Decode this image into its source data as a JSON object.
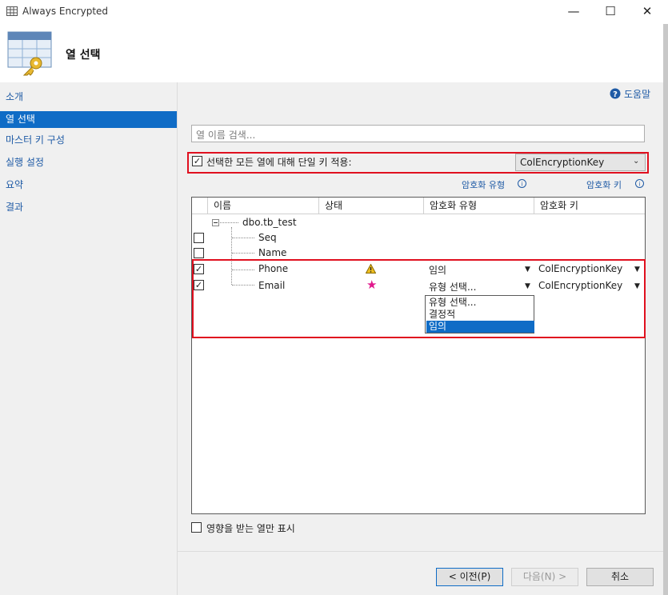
{
  "window": {
    "title": "Always Encrypted",
    "minimize_glyph": "—",
    "maximize_glyph": "☐",
    "close_glyph": "✕"
  },
  "header": {
    "title": "열 선택",
    "icon": "table-key-icon"
  },
  "sidebar": {
    "items": [
      {
        "label": "소개",
        "active": false
      },
      {
        "label": "열 선택",
        "active": true
      },
      {
        "label": "마스터 키 구성",
        "active": false
      },
      {
        "label": "실행 설정",
        "active": false
      },
      {
        "label": "요약",
        "active": false
      },
      {
        "label": "결과",
        "active": false
      }
    ]
  },
  "help": {
    "label": "도움말",
    "icon": "help-icon"
  },
  "search": {
    "placeholder": "열 이름 검색..."
  },
  "single_key": {
    "checked": true,
    "label": "선택한 모든 열에 대해 단일 키 적용:",
    "selected_key": "ColEncryptionKey"
  },
  "links": {
    "encryption_type": "암호화 유형",
    "encryption_key": "암호화 키"
  },
  "grid": {
    "columns": [
      "이름",
      "상태",
      "암호화 유형",
      "암호화 키"
    ],
    "table_node": "dbo.tb_test",
    "rows": [
      {
        "name": "Seq",
        "checked": false,
        "status": "",
        "enc_type": "",
        "enc_key": ""
      },
      {
        "name": "Name",
        "checked": false,
        "status": "",
        "enc_type": "",
        "enc_key": ""
      },
      {
        "name": "Phone",
        "checked": true,
        "status": "warning",
        "enc_type": "임의",
        "enc_key": "ColEncryptionKey"
      },
      {
        "name": "Email",
        "checked": true,
        "status": "new",
        "enc_type": "유형 선택...",
        "enc_key": "ColEncryptionKey"
      }
    ],
    "status_colors": {
      "warning": "#f0c020",
      "new": "#e0188c"
    }
  },
  "type_dropdown": {
    "options": [
      "유형 선택...",
      "결정적",
      "임의"
    ],
    "selected": "임의"
  },
  "affected_only": {
    "checked": false,
    "label": "영향을 받는 열만 표시"
  },
  "buttons": {
    "prev": "< 이전(P)",
    "next": "다음(N) >",
    "cancel": "취소"
  },
  "colors": {
    "accent": "#0f6cc6",
    "highlight_red": "#e0101f",
    "link": "#1e5aa5"
  }
}
